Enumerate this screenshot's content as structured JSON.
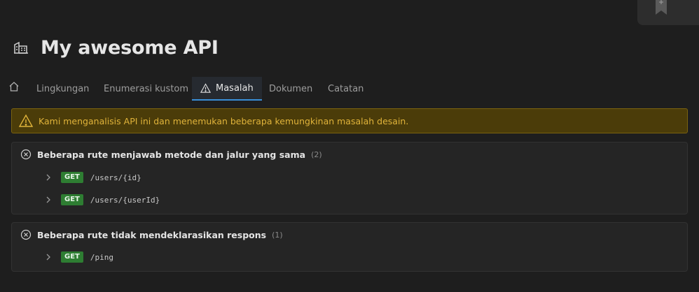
{
  "header": {
    "title": "My awesome API"
  },
  "tabs": [
    {
      "label": "Lingkungan"
    },
    {
      "label": "Enumerasi kustom"
    },
    {
      "label": "Masalah"
    },
    {
      "label": "Dokumen"
    },
    {
      "label": "Catatan"
    }
  ],
  "banner": {
    "text": "Kami menganalisis API ini dan menemukan beberapa kemungkinan masalah desain."
  },
  "issues": [
    {
      "title": "Beberapa rute menjawab metode dan jalur yang sama",
      "count": "(2)",
      "routes": [
        {
          "method": "GET",
          "path": "/users/{id}"
        },
        {
          "method": "GET",
          "path": "/users/{userId}"
        }
      ]
    },
    {
      "title": "Beberapa rute tidak mendeklarasikan respons",
      "count": "(1)",
      "routes": [
        {
          "method": "GET",
          "path": "/ping"
        }
      ]
    }
  ],
  "colors": {
    "background": "#1e1e1e",
    "accent": "#3a8fd8",
    "warning_bg": "#4b3c09",
    "warning_text": "#e0b33a",
    "method_get": "#2e7d32"
  },
  "icons": {
    "corner": "bookmark-plus-icon",
    "title": "api-building-icon",
    "home_tab": "home-icon",
    "issues_tab": "warning-icon",
    "banner": "warning-icon",
    "issue": "circle-x-icon",
    "route": "chevron-right-icon"
  }
}
